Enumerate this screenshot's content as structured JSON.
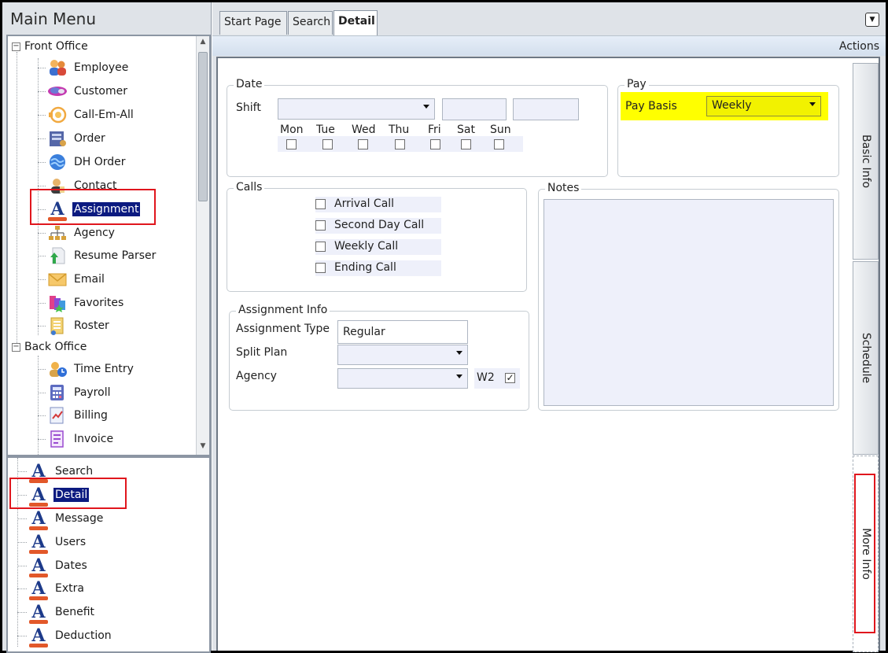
{
  "main_menu": {
    "title": "Main Menu",
    "front_office": {
      "label": "Front Office",
      "items": [
        {
          "label": "Employee",
          "icon": "employee-icon"
        },
        {
          "label": "Customer",
          "icon": "customer-icon"
        },
        {
          "label": "Call-Em-All",
          "icon": "call-em-all-icon"
        },
        {
          "label": "Order",
          "icon": "order-icon"
        },
        {
          "label": "DH Order",
          "icon": "dh-order-icon"
        },
        {
          "label": "Contact",
          "icon": "contact-icon"
        },
        {
          "label": "Assignment",
          "icon": "assignment-icon",
          "selected": true
        },
        {
          "label": "Agency",
          "icon": "agency-icon"
        },
        {
          "label": "Resume Parser",
          "icon": "resume-parser-icon"
        },
        {
          "label": "Email",
          "icon": "email-icon"
        },
        {
          "label": "Favorites",
          "icon": "favorites-icon"
        },
        {
          "label": "Roster",
          "icon": "roster-icon"
        }
      ]
    },
    "back_office": {
      "label": "Back Office",
      "items": [
        {
          "label": "Time Entry",
          "icon": "time-entry-icon"
        },
        {
          "label": "Payroll",
          "icon": "payroll-icon"
        },
        {
          "label": "Billing",
          "icon": "billing-icon"
        },
        {
          "label": "Invoice",
          "icon": "invoice-icon"
        }
      ]
    },
    "sub_items": [
      {
        "label": "Search"
      },
      {
        "label": "Detail",
        "selected": true
      },
      {
        "label": "Message"
      },
      {
        "label": "Users"
      },
      {
        "label": "Dates"
      },
      {
        "label": "Extra"
      },
      {
        "label": "Benefit"
      },
      {
        "label": "Deduction"
      }
    ]
  },
  "tabs": [
    {
      "label": "Start Page"
    },
    {
      "label": "Search"
    },
    {
      "label": "Detail",
      "active": true
    }
  ],
  "actions_label": "Actions",
  "date_group": {
    "title": "Date",
    "shift_label": "Shift",
    "shift_value": "",
    "days": [
      "Mon",
      "Tue",
      "Wed",
      "Thu",
      "Fri",
      "Sat",
      "Sun"
    ]
  },
  "pay_group": {
    "title": "Pay",
    "pay_basis_label": "Pay Basis",
    "pay_basis_value": "Weekly",
    "highlight_color": "#ffff00"
  },
  "calls_group": {
    "title": "Calls",
    "items": [
      "Arrival Call",
      "Second Day Call",
      "Weekly Call",
      "Ending Call"
    ]
  },
  "notes_group": {
    "title": "Notes",
    "value": ""
  },
  "assignment_info": {
    "title": "Assignment Info",
    "assignment_type_label": "Assignment Type",
    "assignment_type_value": "Regular",
    "split_plan_label": "Split Plan",
    "split_plan_value": "",
    "agency_label": "Agency",
    "agency_value": "",
    "w2_label": "W2",
    "w2_checked": true
  },
  "side_tabs": [
    {
      "label": "Basic Info"
    },
    {
      "label": "Schedule"
    },
    {
      "label": "More Info"
    }
  ],
  "colors": {
    "selection": "#0b1a80",
    "highlight_box": "#e0161d",
    "assignment_icon_bar": "#e2582a"
  }
}
